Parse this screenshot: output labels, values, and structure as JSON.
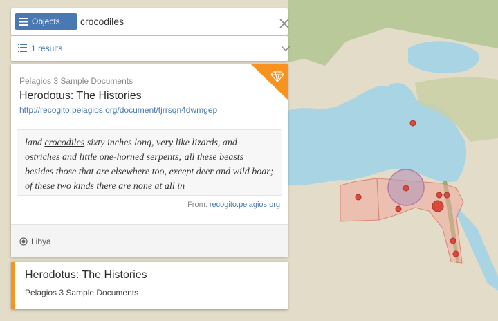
{
  "search": {
    "filter_label": "Objects",
    "query": "crocodiles"
  },
  "results": {
    "count_label": "1 results"
  },
  "result_card": {
    "source": "Pelagios 3 Sample Documents",
    "title": "Herodotus: The Histories",
    "url": "http://recogito.pelagios.org/document/tjrrsqn4dwmgep",
    "snippet_before": "land ",
    "snippet_highlight": "crocodiles",
    "snippet_after": " sixty inches long, very like lizards, and ostriches and little one-horned serpents; all these beasts besides those that are elsewhere too, except deer and wild boar; of these two kinds there are none at all in",
    "from_label": "From:",
    "from_link": "recogito.pelagios.org",
    "place": "Libya",
    "accent_color": "#f7931e"
  },
  "second_card": {
    "title": "Herodotus: The Histories",
    "source": "Pelagios 3 Sample Documents"
  },
  "colors": {
    "button_blue": "#4a78b2",
    "marker_red": "#d94a3c",
    "region_fill": "#f2a99c"
  }
}
